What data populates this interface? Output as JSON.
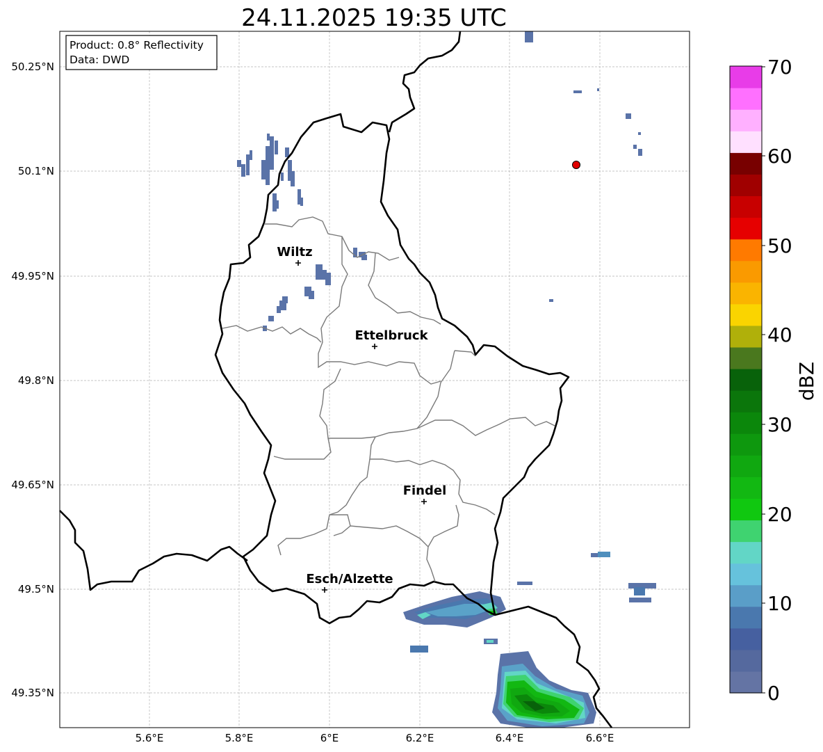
{
  "title": "24.11.2025 19:35 UTC",
  "info_box": {
    "product": "Product: 0.8° Reflectivity",
    "data": "Data: DWD"
  },
  "lat_ticks": [
    "50.25°N",
    "50.1°N",
    "49.95°N",
    "49.8°N",
    "49.65°N",
    "49.5°N",
    "49.35°N"
  ],
  "lon_ticks": [
    "5.6°E",
    "5.8°E",
    "6°E",
    "6.2°E",
    "6.4°E",
    "6.6°E"
  ],
  "cities": [
    {
      "name": "Wiltz",
      "lon": 5.93,
      "lat": 49.966
    },
    {
      "name": "Ettelbruck",
      "lon": 6.1,
      "lat": 49.85
    },
    {
      "name": "Findel",
      "lon": 6.21,
      "lat": 49.627
    },
    {
      "name": "Esch/Alzette",
      "lon": 5.99,
      "lat": 49.499
    }
  ],
  "marker": {
    "lon": 6.546,
    "lat": 50.11,
    "color": "#e00000"
  },
  "colorbar": {
    "label": "dBZ",
    "ticks": [
      "0",
      "10",
      "20",
      "30",
      "40",
      "50",
      "60",
      "70"
    ],
    "colors": [
      "#6474a4",
      "#55699e",
      "#4660a0",
      "#4a78ae",
      "#5a9ec8",
      "#66c2dc",
      "#62d6c6",
      "#3fd370",
      "#10c810",
      "#12b812",
      "#10a810",
      "#0e980e",
      "#0b870b",
      "#0b760b",
      "#08620a",
      "#4a781e",
      "#b0b00a",
      "#fad400",
      "#fab400",
      "#fa9a00",
      "#ff7a00",
      "#e60000",
      "#c80000",
      "#a00000",
      "#780000",
      "#ffe0ff",
      "#ffb0ff",
      "#ff70ff",
      "#e83ce8"
    ]
  }
}
